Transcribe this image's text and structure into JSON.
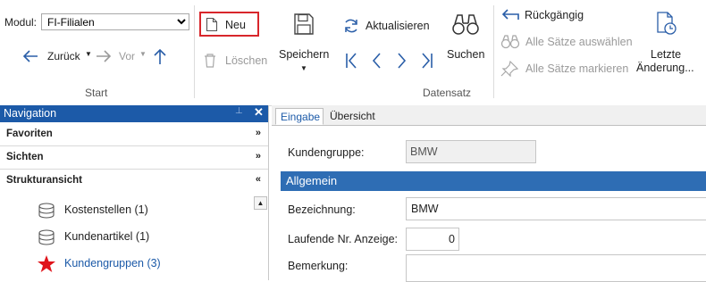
{
  "ribbon": {
    "modul_label": "Modul:",
    "modul_value": "FI-Filialen",
    "back_label": "Zurück",
    "forward_label": "Vor",
    "group_start_label": "Start",
    "new_label": "Neu",
    "delete_label": "Löschen",
    "save_label": "Speichern",
    "refresh_label": "Aktualisieren",
    "search_label": "Suchen",
    "group_record_label": "Datensatz",
    "undo_label": "Rückgängig",
    "select_all_label": "Alle Sätze auswählen",
    "mark_all_label": "Alle Sätze markieren",
    "last_change_label_1": "Letzte",
    "last_change_label_2": "Änderung..."
  },
  "navigation": {
    "title": "Navigation",
    "sections": [
      {
        "label": "Favoriten",
        "state": "collapsed"
      },
      {
        "label": "Sichten",
        "state": "collapsed"
      },
      {
        "label": "Strukturansicht",
        "state": "expanded"
      }
    ],
    "tree_items": [
      {
        "label": "Kostenstellen (1)",
        "icon": "database-icon",
        "active": false
      },
      {
        "label": "Kundenartikel (1)",
        "icon": "database-icon",
        "active": false
      },
      {
        "label": "Kundengruppen (3)",
        "icon": "star-icon",
        "active": true
      }
    ]
  },
  "main": {
    "tabs": [
      {
        "label": "Eingabe",
        "active": true
      },
      {
        "label": "Übersicht",
        "active": false
      }
    ],
    "kundengruppe_label": "Kundengruppe:",
    "kundengruppe_value": "BMW",
    "section_title": "Allgemein",
    "bezeichnung_label": "Bezeichnung:",
    "bezeichnung_value": "BMW",
    "laufende_label": "Laufende Nr. Anzeige:",
    "laufende_value": "0",
    "bemerkung_label": "Bemerkung:",
    "bemerkung_value": ""
  },
  "colors": {
    "accent_blue": "#1c5aa8",
    "section_blue": "#2e6db4",
    "highlight_red": "#d8262b",
    "star_red": "#e0141b"
  }
}
